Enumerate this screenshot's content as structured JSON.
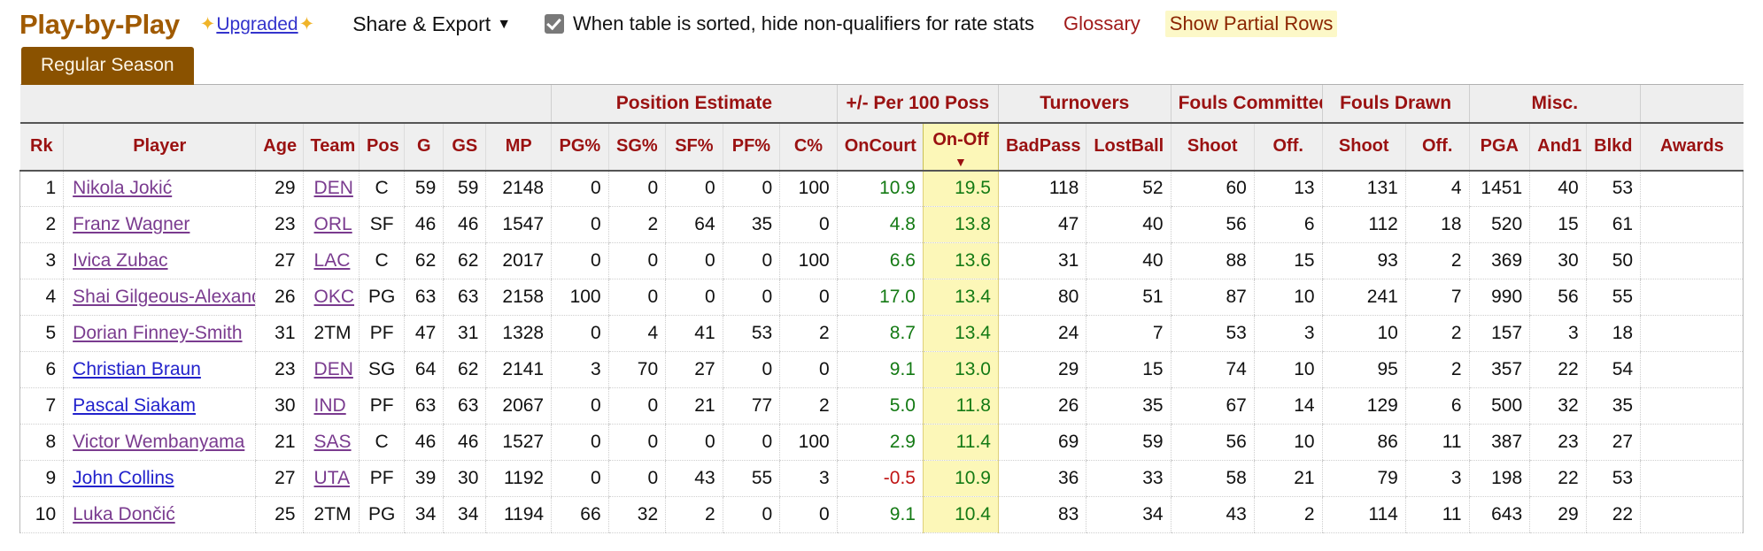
{
  "header": {
    "title": "Play-by-Play",
    "upgraded_label": "Upgraded",
    "sparkle_icon": "sparkles-icon",
    "share_export_label": "Share & Export",
    "share_export_caret": "▼",
    "qualifier_checkbox_label": "When table is sorted, hide non-qualifiers for rate stats",
    "qualifier_checked": true,
    "glossary_label": "Glossary",
    "partial_rows_label": "Show Partial Rows",
    "colors": {
      "title": "#a05a00",
      "link": "#3333cc",
      "sparkle": "#f0b429",
      "glossary": "#a11b1b",
      "partial_rows_text": "#8b2500",
      "partial_rows_bg": "#fcf8c8",
      "tab_bg": "#8a5200",
      "header_text": "#9a1111",
      "sorted_col_bg": "#fcf7b8",
      "positive": "#147a14",
      "negative": "#c01414"
    }
  },
  "tabs": [
    {
      "label": "Regular Season",
      "active": true
    }
  ],
  "table": {
    "group_headers": [
      {
        "label": "",
        "span": 8
      },
      {
        "label": "Position Estimate",
        "span": 5
      },
      {
        "label": "+/- Per 100 Poss",
        "span": 2
      },
      {
        "label": "Turnovers",
        "span": 2
      },
      {
        "label": "Fouls Committed",
        "span": 2
      },
      {
        "label": "Fouls Drawn",
        "span": 2
      },
      {
        "label": "Misc.",
        "span": 3
      },
      {
        "label": "",
        "span": 1
      }
    ],
    "columns": [
      {
        "key": "rk",
        "label": "Rk"
      },
      {
        "key": "player",
        "label": "Player"
      },
      {
        "key": "age",
        "label": "Age"
      },
      {
        "key": "team",
        "label": "Team"
      },
      {
        "key": "pos",
        "label": "Pos"
      },
      {
        "key": "g",
        "label": "G"
      },
      {
        "key": "gs",
        "label": "GS"
      },
      {
        "key": "mp",
        "label": "MP"
      },
      {
        "key": "pg_pct",
        "label": "PG%"
      },
      {
        "key": "sg_pct",
        "label": "SG%"
      },
      {
        "key": "sf_pct",
        "label": "SF%"
      },
      {
        "key": "pf_pct",
        "label": "PF%"
      },
      {
        "key": "c_pct",
        "label": "C%"
      },
      {
        "key": "oncourt",
        "label": "OnCourt"
      },
      {
        "key": "onoff",
        "label": "On-Off",
        "sorted": true,
        "sort_dir": "▼"
      },
      {
        "key": "badpass",
        "label": "BadPass"
      },
      {
        "key": "lostball",
        "label": "LostBall"
      },
      {
        "key": "fc_shoot",
        "label": "Shoot"
      },
      {
        "key": "fc_off",
        "label": "Off."
      },
      {
        "key": "fd_shoot",
        "label": "Shoot"
      },
      {
        "key": "fd_off",
        "label": "Off."
      },
      {
        "key": "pga",
        "label": "PGA"
      },
      {
        "key": "and1",
        "label": "And1"
      },
      {
        "key": "blkd",
        "label": "Blkd"
      },
      {
        "key": "awards",
        "label": "Awards"
      }
    ],
    "rows": [
      {
        "rk": "1",
        "player": "Nikola Jokić",
        "player_visited": true,
        "age": "29",
        "team": "DEN",
        "team_link": true,
        "pos": "C",
        "g": "59",
        "gs": "59",
        "mp": "2148",
        "pg_pct": "0",
        "sg_pct": "0",
        "sf_pct": "0",
        "pf_pct": "0",
        "c_pct": "100",
        "oncourt": "10.9",
        "onoff": "19.5",
        "badpass": "118",
        "lostball": "52",
        "fc_shoot": "60",
        "fc_off": "13",
        "fd_shoot": "131",
        "fd_off": "4",
        "pga": "1451",
        "and1": "40",
        "blkd": "53",
        "awards": ""
      },
      {
        "rk": "2",
        "player": "Franz Wagner",
        "player_visited": true,
        "age": "23",
        "team": "ORL",
        "team_link": true,
        "pos": "SF",
        "g": "46",
        "gs": "46",
        "mp": "1547",
        "pg_pct": "0",
        "sg_pct": "2",
        "sf_pct": "64",
        "pf_pct": "35",
        "c_pct": "0",
        "oncourt": "4.8",
        "onoff": "13.8",
        "badpass": "47",
        "lostball": "40",
        "fc_shoot": "56",
        "fc_off": "6",
        "fd_shoot": "112",
        "fd_off": "18",
        "pga": "520",
        "and1": "15",
        "blkd": "61",
        "awards": ""
      },
      {
        "rk": "3",
        "player": "Ivica Zubac",
        "player_visited": true,
        "age": "27",
        "team": "LAC",
        "team_link": true,
        "pos": "C",
        "g": "62",
        "gs": "62",
        "mp": "2017",
        "pg_pct": "0",
        "sg_pct": "0",
        "sf_pct": "0",
        "pf_pct": "0",
        "c_pct": "100",
        "oncourt": "6.6",
        "onoff": "13.6",
        "badpass": "31",
        "lostball": "40",
        "fc_shoot": "88",
        "fc_off": "15",
        "fd_shoot": "93",
        "fd_off": "2",
        "pga": "369",
        "and1": "30",
        "blkd": "50",
        "awards": ""
      },
      {
        "rk": "4",
        "player": "Shai Gilgeous-Alexander",
        "player_visited": true,
        "age": "26",
        "team": "OKC",
        "team_link": true,
        "pos": "PG",
        "g": "63",
        "gs": "63",
        "mp": "2158",
        "pg_pct": "100",
        "sg_pct": "0",
        "sf_pct": "0",
        "pf_pct": "0",
        "c_pct": "0",
        "oncourt": "17.0",
        "onoff": "13.4",
        "badpass": "80",
        "lostball": "51",
        "fc_shoot": "87",
        "fc_off": "10",
        "fd_shoot": "241",
        "fd_off": "7",
        "pga": "990",
        "and1": "56",
        "blkd": "55",
        "awards": ""
      },
      {
        "rk": "5",
        "player": "Dorian Finney-Smith",
        "player_visited": true,
        "age": "31",
        "team": "2TM",
        "team_link": false,
        "pos": "PF",
        "g": "47",
        "gs": "31",
        "mp": "1328",
        "pg_pct": "0",
        "sg_pct": "4",
        "sf_pct": "41",
        "pf_pct": "53",
        "c_pct": "2",
        "oncourt": "8.7",
        "onoff": "13.4",
        "badpass": "24",
        "lostball": "7",
        "fc_shoot": "53",
        "fc_off": "3",
        "fd_shoot": "10",
        "fd_off": "2",
        "pga": "157",
        "and1": "3",
        "blkd": "18",
        "awards": ""
      },
      {
        "rk": "6",
        "player": "Christian Braun",
        "player_visited": false,
        "age": "23",
        "team": "DEN",
        "team_link": true,
        "pos": "SG",
        "g": "64",
        "gs": "62",
        "mp": "2141",
        "pg_pct": "3",
        "sg_pct": "70",
        "sf_pct": "27",
        "pf_pct": "0",
        "c_pct": "0",
        "oncourt": "9.1",
        "onoff": "13.0",
        "badpass": "29",
        "lostball": "15",
        "fc_shoot": "74",
        "fc_off": "10",
        "fd_shoot": "95",
        "fd_off": "2",
        "pga": "357",
        "and1": "22",
        "blkd": "54",
        "awards": ""
      },
      {
        "rk": "7",
        "player": "Pascal Siakam",
        "player_visited": false,
        "age": "30",
        "team": "IND",
        "team_link": true,
        "pos": "PF",
        "g": "63",
        "gs": "63",
        "mp": "2067",
        "pg_pct": "0",
        "sg_pct": "0",
        "sf_pct": "21",
        "pf_pct": "77",
        "c_pct": "2",
        "oncourt": "5.0",
        "onoff": "11.8",
        "badpass": "26",
        "lostball": "35",
        "fc_shoot": "67",
        "fc_off": "14",
        "fd_shoot": "129",
        "fd_off": "6",
        "pga": "500",
        "and1": "32",
        "blkd": "35",
        "awards": ""
      },
      {
        "rk": "8",
        "player": "Victor Wembanyama",
        "player_visited": true,
        "age": "21",
        "team": "SAS",
        "team_link": true,
        "pos": "C",
        "g": "46",
        "gs": "46",
        "mp": "1527",
        "pg_pct": "0",
        "sg_pct": "0",
        "sf_pct": "0",
        "pf_pct": "0",
        "c_pct": "100",
        "oncourt": "2.9",
        "onoff": "11.4",
        "badpass": "69",
        "lostball": "59",
        "fc_shoot": "56",
        "fc_off": "10",
        "fd_shoot": "86",
        "fd_off": "11",
        "pga": "387",
        "and1": "23",
        "blkd": "27",
        "awards": ""
      },
      {
        "rk": "9",
        "player": "John Collins",
        "player_visited": false,
        "age": "27",
        "team": "UTA",
        "team_link": true,
        "pos": "PF",
        "g": "39",
        "gs": "30",
        "mp": "1192",
        "pg_pct": "0",
        "sg_pct": "0",
        "sf_pct": "43",
        "pf_pct": "55",
        "c_pct": "3",
        "oncourt": "-0.5",
        "onoff": "10.9",
        "badpass": "36",
        "lostball": "33",
        "fc_shoot": "58",
        "fc_off": "21",
        "fd_shoot": "79",
        "fd_off": "3",
        "pga": "198",
        "and1": "22",
        "blkd": "53",
        "awards": ""
      },
      {
        "rk": "10",
        "player": "Luka Dončić",
        "player_visited": true,
        "age": "25",
        "team": "2TM",
        "team_link": false,
        "pos": "PG",
        "g": "34",
        "gs": "34",
        "mp": "1194",
        "pg_pct": "66",
        "sg_pct": "32",
        "sf_pct": "2",
        "pf_pct": "0",
        "c_pct": "0",
        "oncourt": "9.1",
        "onoff": "10.4",
        "badpass": "83",
        "lostball": "34",
        "fc_shoot": "43",
        "fc_off": "2",
        "fd_shoot": "114",
        "fd_off": "11",
        "pga": "643",
        "and1": "29",
        "blkd": "22",
        "awards": ""
      }
    ]
  }
}
